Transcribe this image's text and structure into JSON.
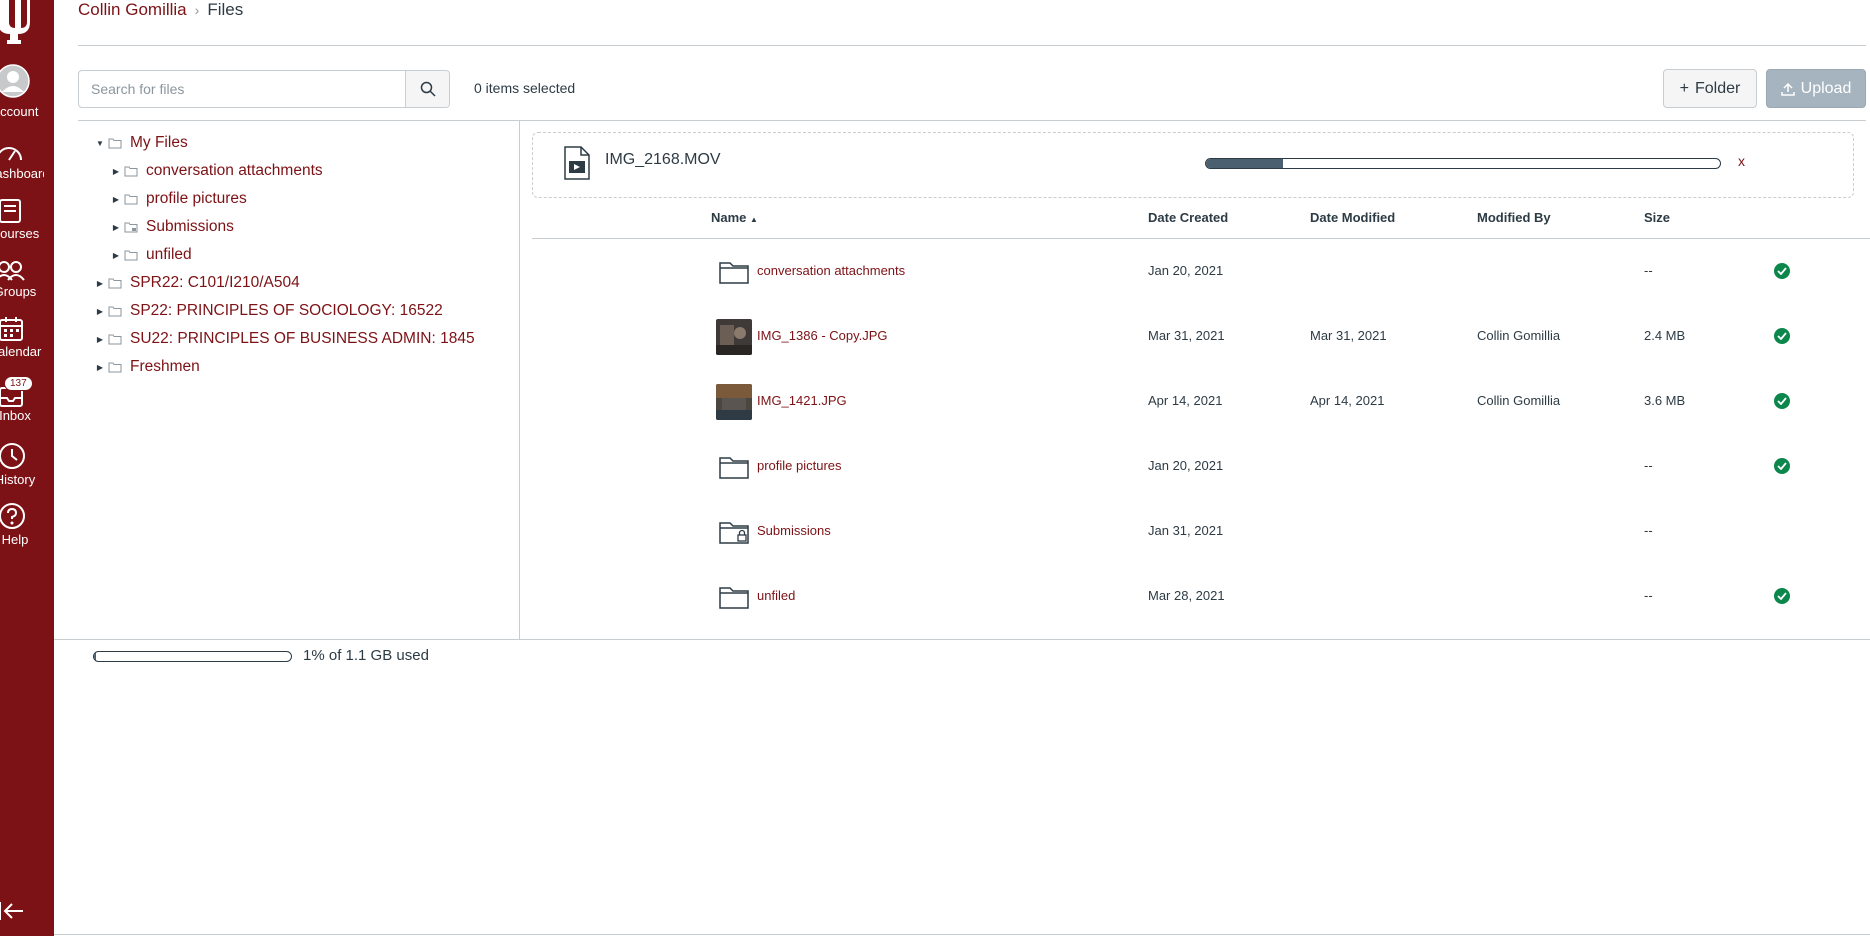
{
  "nav": {
    "items": [
      {
        "label": "Account",
        "icon": "account-icon"
      },
      {
        "label": "Dashboard",
        "icon": "dashboard-icon"
      },
      {
        "label": "Courses",
        "icon": "courses-icon"
      },
      {
        "label": "Groups",
        "icon": "groups-icon"
      },
      {
        "label": "Calendar",
        "icon": "calendar-icon"
      },
      {
        "label": "Inbox",
        "icon": "inbox-icon",
        "badge": "137"
      },
      {
        "label": "History",
        "icon": "history-icon"
      },
      {
        "label": "Help",
        "icon": "help-icon"
      }
    ],
    "brand_color": "#7d1216"
  },
  "breadcrumb": {
    "user": "Collin Gomillia",
    "current": "Files"
  },
  "toolbar": {
    "search_placeholder": "Search for files",
    "selected_count": "0 items selected",
    "folder_label": "Folder",
    "upload_label": "Upload"
  },
  "tree": {
    "root": "My Files",
    "children": [
      "conversation attachments",
      "profile pictures",
      "Submissions",
      "unfiled"
    ],
    "courses": [
      "SPR22: C101/I210/A504",
      "SP22: PRINCIPLES OF SOCIOLOGY: 16522",
      "SU22: PRINCIPLES OF BUSINESS ADMIN: 1845",
      "Freshmen"
    ]
  },
  "upload": {
    "file_name": "IMG_2168.MOV",
    "progress_fraction": 0.15,
    "cancel_label": "x"
  },
  "table": {
    "headers": {
      "name": "Name",
      "date_created": "Date Created",
      "date_modified": "Date Modified",
      "modified_by": "Modified By",
      "size": "Size"
    },
    "rows": [
      {
        "type": "folder",
        "name": "conversation attachments",
        "created": "Jan 20, 2021",
        "modified": "",
        "by": "",
        "size": "--",
        "published": true
      },
      {
        "type": "image",
        "name": "IMG_1386 - Copy.JPG",
        "created": "Mar 31, 2021",
        "modified": "Mar 31, 2021",
        "by": "Collin Gomillia",
        "size": "2.4 MB",
        "published": true
      },
      {
        "type": "image",
        "name": "IMG_1421.JPG",
        "created": "Apr 14, 2021",
        "modified": "Apr 14, 2021",
        "by": "Collin Gomillia",
        "size": "3.6 MB",
        "published": true
      },
      {
        "type": "folder",
        "name": "profile pictures",
        "created": "Jan 20, 2021",
        "modified": "",
        "by": "",
        "size": "--",
        "published": true
      },
      {
        "type": "locked-folder",
        "name": "Submissions",
        "created": "Jan 31, 2021",
        "modified": "",
        "by": "",
        "size": "--",
        "published": false
      },
      {
        "type": "folder",
        "name": "unfiled",
        "created": "Mar 28, 2021",
        "modified": "",
        "by": "",
        "size": "--",
        "published": true
      }
    ]
  },
  "quota": {
    "text": "1% of 1.1 GB used",
    "fraction": 0.01
  },
  "colors": {
    "link": "#7d1216",
    "published": "#0b874b"
  }
}
